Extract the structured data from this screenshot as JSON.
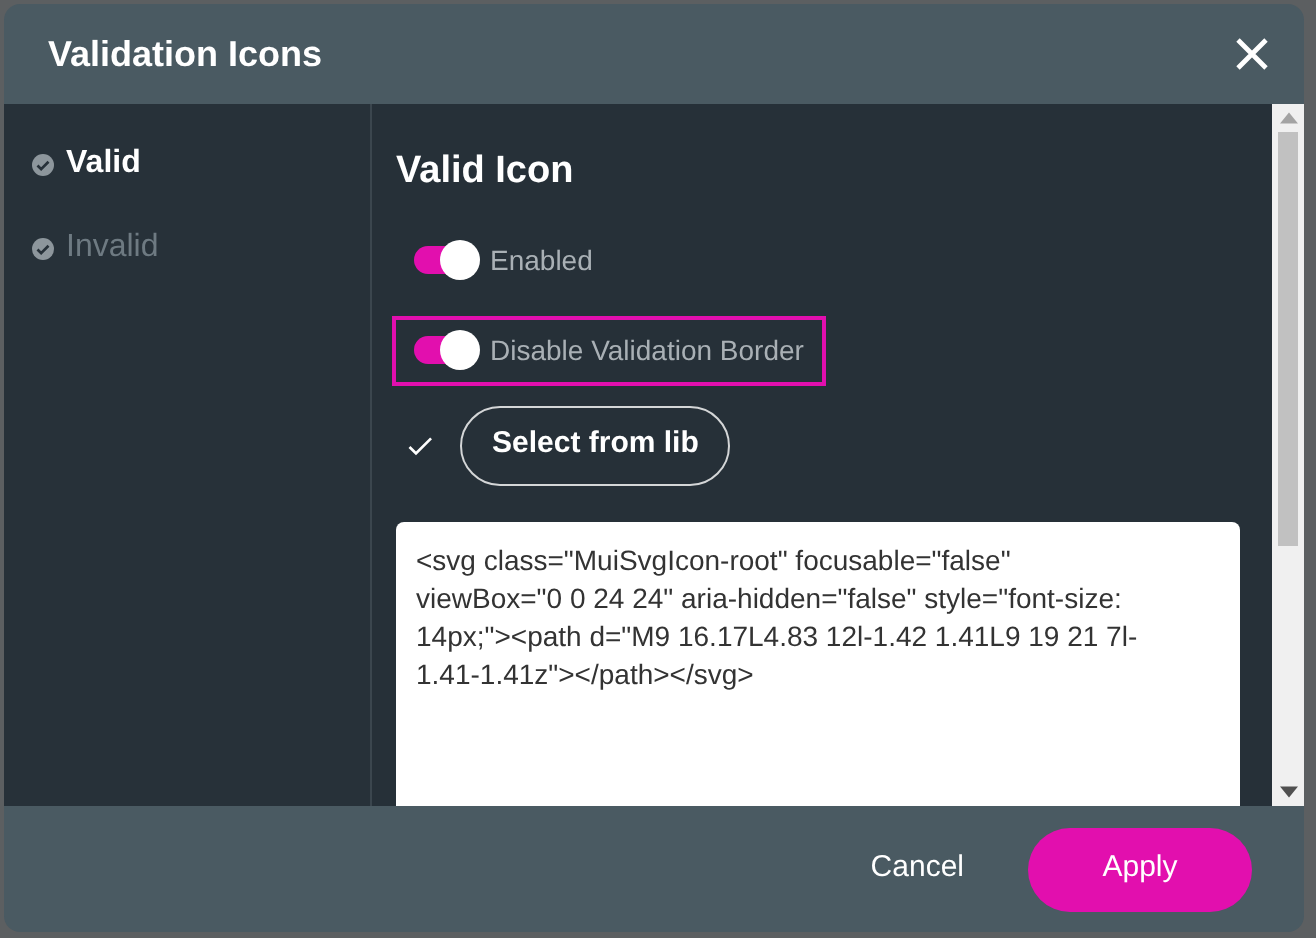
{
  "dialog": {
    "title": "Validation Icons"
  },
  "sidebar": {
    "items": [
      {
        "label": "Valid",
        "selected": true
      },
      {
        "label": "Invalid",
        "selected": false
      }
    ]
  },
  "content": {
    "heading": "Valid Icon",
    "toggles": [
      {
        "label": "Enabled",
        "on": true,
        "focused": false
      },
      {
        "label": "Disable Validation Border",
        "on": true,
        "focused": true
      }
    ],
    "select_button": "Select from lib",
    "code": "<svg class=\"MuiSvgIcon-root\" focusable=\"false\" viewBox=\"0 0 24 24\" aria-hidden=\"false\" style=\"font-size: 14px;\"><path d=\"M9 16.17L4.83 12l-1.42 1.41L9 19 21 7l-1.41-1.41z\"></path></svg>"
  },
  "footer": {
    "buttons": [
      {
        "label": "Cancel",
        "kind": "text"
      },
      {
        "label": "Apply",
        "kind": "primary"
      }
    ]
  }
}
